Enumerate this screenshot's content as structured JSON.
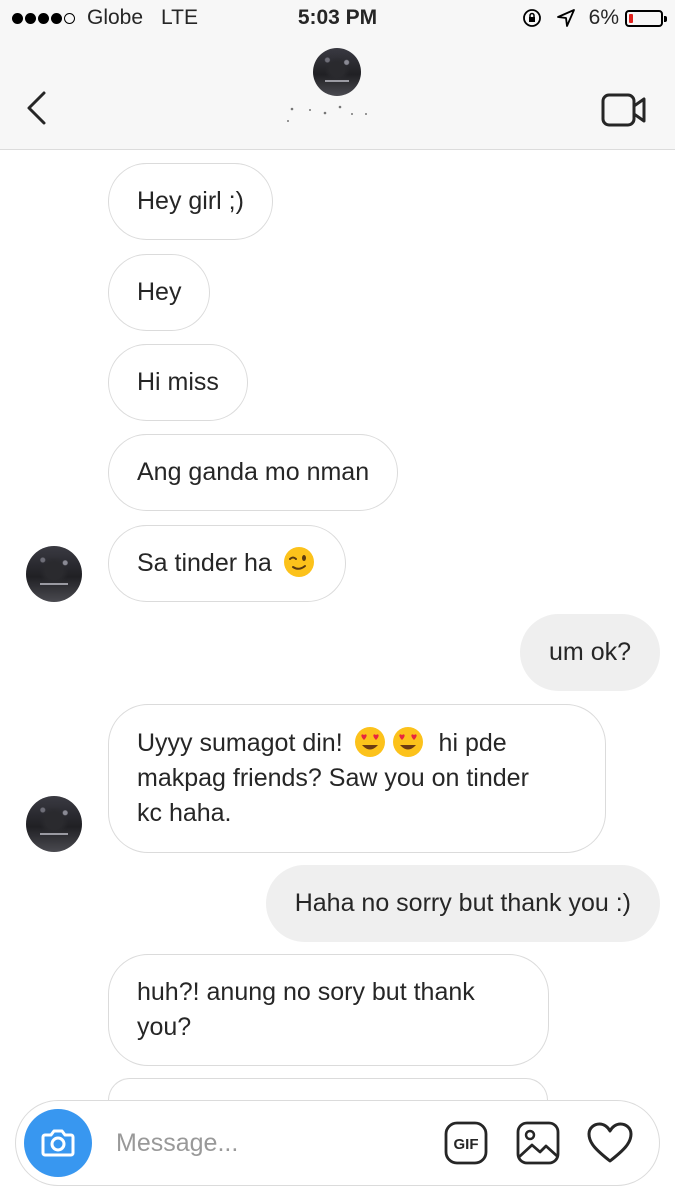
{
  "status_bar": {
    "carrier": "Globe",
    "network": "LTE",
    "time": "5:03 PM",
    "battery": "6%",
    "signal_bars": 4,
    "battery_level": 0.06
  },
  "header": {
    "contact_avatar": "profile-photo",
    "back_icon": "chevron-left-icon",
    "video_icon": "video-camera-icon"
  },
  "messages": [
    {
      "direction": "incoming",
      "text": "Hey girl ;)"
    },
    {
      "direction": "incoming",
      "text": "Hey"
    },
    {
      "direction": "incoming",
      "text": "Hi miss"
    },
    {
      "direction": "incoming",
      "text": "Ang ganda mo nman"
    },
    {
      "direction": "incoming",
      "text": "Sa tinder ha",
      "emoji": "winking-face"
    },
    {
      "direction": "outgoing",
      "text": "um ok?"
    },
    {
      "direction": "incoming",
      "line1a": "Uyyy sumagot din!",
      "line1b": "hi pde",
      "line2": "makpag friends? Saw you on tinder",
      "line3": "kc haha.",
      "emoji": "heart-eyes-face"
    },
    {
      "direction": "outgoing",
      "text": "Haha no sorry but thank you :)"
    },
    {
      "direction": "incoming",
      "line1": "huh?! anung no sory but thank",
      "line2": "you?"
    }
  ],
  "composer": {
    "placeholder": "Message...",
    "camera_icon": "camera-icon",
    "gif_label": "GIF",
    "gallery_icon": "image-icon",
    "like_icon": "heart-icon"
  },
  "colors": {
    "accent": "#3897f0",
    "incoming_border": "#dbdbdb",
    "outgoing_bg": "#efefef",
    "battery_low": "#e0201c"
  }
}
